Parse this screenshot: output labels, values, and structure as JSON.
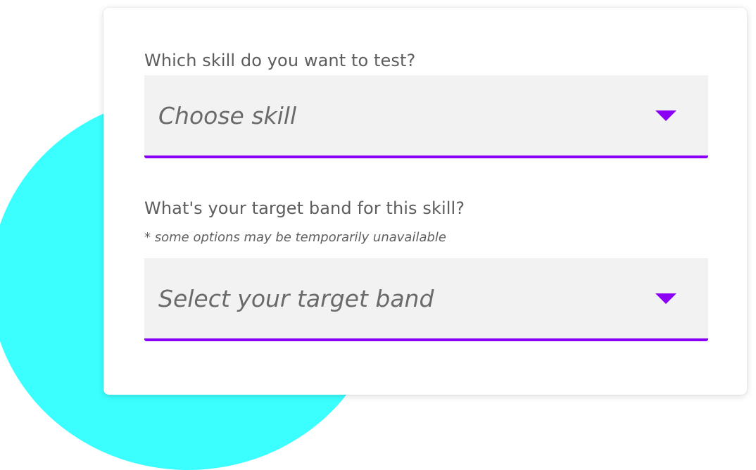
{
  "form": {
    "skill": {
      "label": "Which skill do you want to test?",
      "placeholder": "Choose skill"
    },
    "band": {
      "label": "What's your target band for this skill?",
      "hint": "* some options may be temporarily unavailable",
      "placeholder": "Select your target band"
    }
  },
  "colors": {
    "accent": "#8b00f5",
    "decor_circle": "#3bffff",
    "field_bg": "#f2f2f2",
    "text": "#5d5d5d"
  },
  "icons": {
    "dropdown": "caret-down-icon"
  }
}
